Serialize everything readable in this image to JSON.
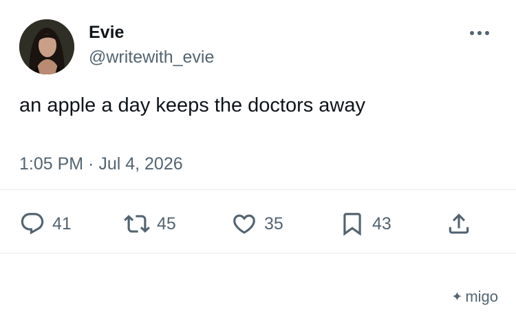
{
  "author": {
    "name": "Evie",
    "handle": "@writewith_evie",
    "avatar": "avatar-photo"
  },
  "tweet": {
    "text": "an apple a day keeps the doctors away",
    "timestamp": "1:05 PM · Jul 4, 2026"
  },
  "actions": {
    "replies": "41",
    "retweets": "45",
    "likes": "35",
    "bookmarks": "43"
  },
  "brand": {
    "icon": "✦",
    "label": "migo"
  },
  "icons": {
    "more": "more-horizontal-icon",
    "reply": "reply-icon",
    "retweet": "retweet-icon",
    "like": "heart-icon",
    "bookmark": "bookmark-icon",
    "share": "share-icon"
  },
  "colors": {
    "text": "#0f1419",
    "secondary": "#536471",
    "divider": "#e7e9ea"
  }
}
